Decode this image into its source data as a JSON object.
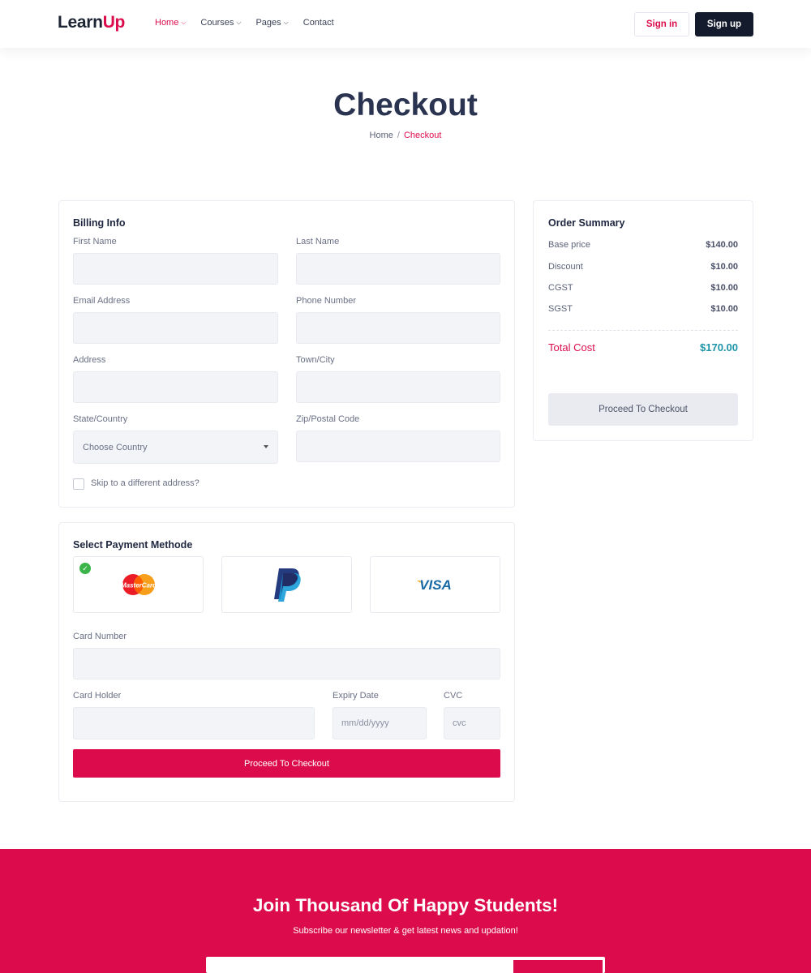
{
  "brand": {
    "logo_main": "Learn",
    "logo_accent": "Up",
    "accent_color": "#dc0c4c",
    "dark_color": "#131b2c"
  },
  "nav": {
    "items": [
      {
        "label": "Home",
        "active": true,
        "has_dropdown": true
      },
      {
        "label": "Courses",
        "active": false,
        "has_dropdown": true
      },
      {
        "label": "Pages",
        "active": false,
        "has_dropdown": true
      },
      {
        "label": "Contact",
        "active": false,
        "has_dropdown": false
      }
    ],
    "signin_label": "Sign in",
    "signup_label": "Sign up"
  },
  "page": {
    "title": "Checkout",
    "breadcrumb": {
      "home": "Home",
      "separator": "/",
      "current": "Checkout"
    }
  },
  "billing": {
    "title": "Billing Info",
    "fields": {
      "first_name": {
        "label": "First Name",
        "value": ""
      },
      "last_name": {
        "label": "Last Name",
        "value": ""
      },
      "email": {
        "label": "Email Address",
        "value": ""
      },
      "phone": {
        "label": "Phone Number",
        "value": ""
      },
      "address": {
        "label": "Address",
        "value": ""
      },
      "city": {
        "label": "Town/City",
        "value": ""
      },
      "state": {
        "label": "State/Country",
        "selected": "Choose Country"
      },
      "zip": {
        "label": "Zip/Postal Code",
        "value": ""
      }
    },
    "skip_label": "Skip to a different address?",
    "skip_checked": false
  },
  "payment": {
    "title": "Select Payment Methode",
    "methods": [
      {
        "name": "MasterCard",
        "icon": "mastercard-icon",
        "selected": true
      },
      {
        "name": "PayPal",
        "icon": "paypal-icon",
        "selected": false
      },
      {
        "name": "VISA",
        "icon": "visa-icon",
        "selected": false
      }
    ],
    "card_number": {
      "label": "Card Number",
      "value": ""
    },
    "card_holder": {
      "label": "Card Holder",
      "value": ""
    },
    "expiry": {
      "label": "Expiry Date",
      "placeholder": "mm/dd/yyyy"
    },
    "cvc": {
      "label": "CVC",
      "placeholder": "cvc"
    },
    "submit_label": "Proceed To Checkout"
  },
  "summary": {
    "title": "Order Summary",
    "rows": [
      {
        "label": "Base price",
        "value": "$140.00"
      },
      {
        "label": "Discount",
        "value": "$10.00"
      },
      {
        "label": "CGST",
        "value": "$10.00"
      },
      {
        "label": "SGST",
        "value": "$10.00"
      }
    ],
    "total_label": "Total Cost",
    "total_value": "$170.00",
    "button_label": "Proceed To Checkout"
  },
  "newsletter": {
    "title": "Join Thousand Of Happy Students!",
    "subtitle": "Subscribe our newsletter & get latest news and updation!"
  }
}
